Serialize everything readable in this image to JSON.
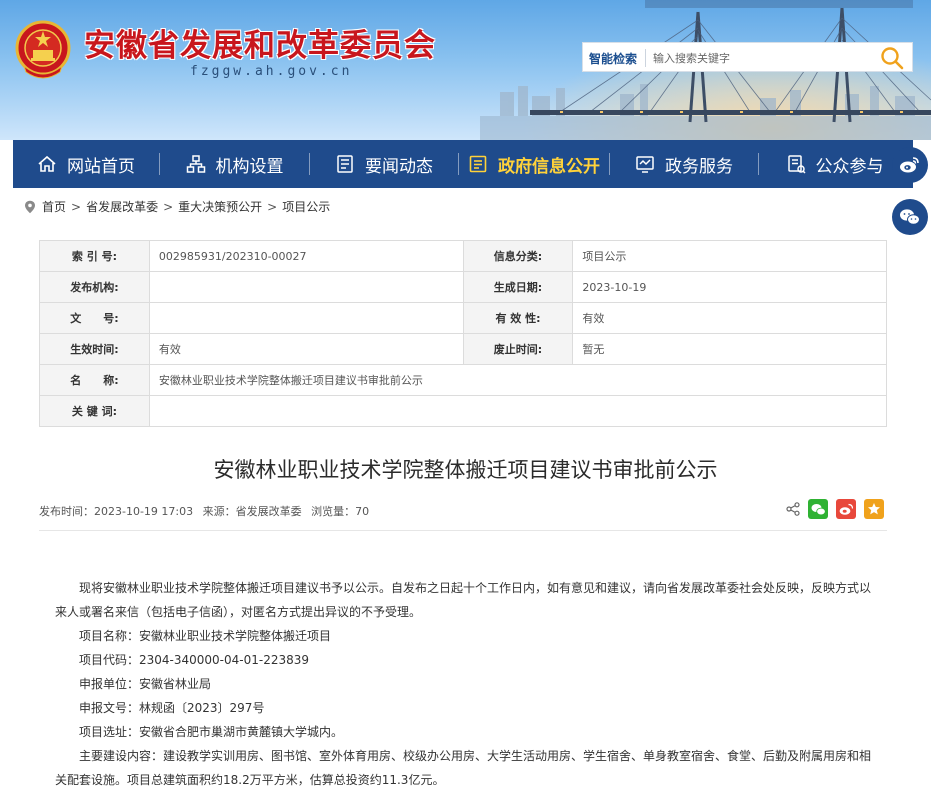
{
  "header": {
    "site_title": "安徽省发展和改革委员会",
    "site_domain": "fzggw.ah.gov.cn",
    "search_label": "智能检索",
    "search_placeholder": "输入搜索关键字"
  },
  "nav": {
    "items": [
      {
        "label": "网站首页",
        "icon": "home-icon",
        "active": false
      },
      {
        "label": "机构设置",
        "icon": "org-chart-icon",
        "active": false
      },
      {
        "label": "要闻动态",
        "icon": "news-icon",
        "active": false
      },
      {
        "label": "政府信息公开",
        "icon": "info-disclosure-icon",
        "active": true
      },
      {
        "label": "政务服务",
        "icon": "service-icon",
        "active": false
      },
      {
        "label": "公众参与",
        "icon": "participation-icon",
        "active": false
      }
    ]
  },
  "breadcrumb": [
    "首页",
    "省发展改革委",
    "重大决策预公开",
    "项目公示"
  ],
  "info": {
    "index_label": "索 引 号:",
    "index_value": "002985931/202310-00027",
    "category_label": "信息分类:",
    "category_value": "项目公示",
    "publisher_label": "发布机构:",
    "publisher_value": "",
    "date_label": "生成日期:",
    "date_value": "2023-10-19",
    "doc_label": "文　　号:",
    "doc_value": "",
    "validity_label": "有 效 性:",
    "validity_value": "有效",
    "effective_label": "生效时间:",
    "effective_value": "有效",
    "expire_label": "废止时间:",
    "expire_value": "暂无",
    "name_label": "名　　称:",
    "name_value": "安徽林业职业技术学院整体搬迁项目建议书审批前公示",
    "keywords_label": "关 键 词:",
    "keywords_value": ""
  },
  "article": {
    "title": "安徽林业职业技术学院整体搬迁项目建议书审批前公示",
    "meta_time": "发布时间：2023-10-19 17:03",
    "meta_source": "来源：省发展改革委",
    "meta_views": "浏览量：70",
    "intro_a": "现将安徽林业职业技术学院整体搬迁项目建议书予以公示。自发布之日起十个工作日内，如有意见和建议，请向省发展改革委社会处反映，反映方式以",
    "intro_b": "来人或署名来信（包括电子信函），对匿名方式提出异议的不予受理。",
    "lines": [
      "项目名称：安徽林业职业技术学院整体搬迁项目",
      "项目代码：2304-340000-04-01-223839",
      "申报单位：安徽省林业局",
      "申报文号：林规函〔2023〕297号",
      "项目选址：安徽省合肥市巢湖市黄麓镇大学城内。"
    ],
    "construction_a": "主要建设内容：建设教学实训用房、图书馆、室外体育用房、校级办公用房、大学生活动用房、学生宿舍、单身教室宿舍、食堂、后勤及附属用房和相",
    "construction_b": "关配套设施。项目总建筑面积约18.2万平方米，估算总投资约11.3亿元。"
  },
  "colors": {
    "nav_bg": "#1f4b8c",
    "nav_active": "#ffd23a",
    "title_red": "#c8161d"
  }
}
